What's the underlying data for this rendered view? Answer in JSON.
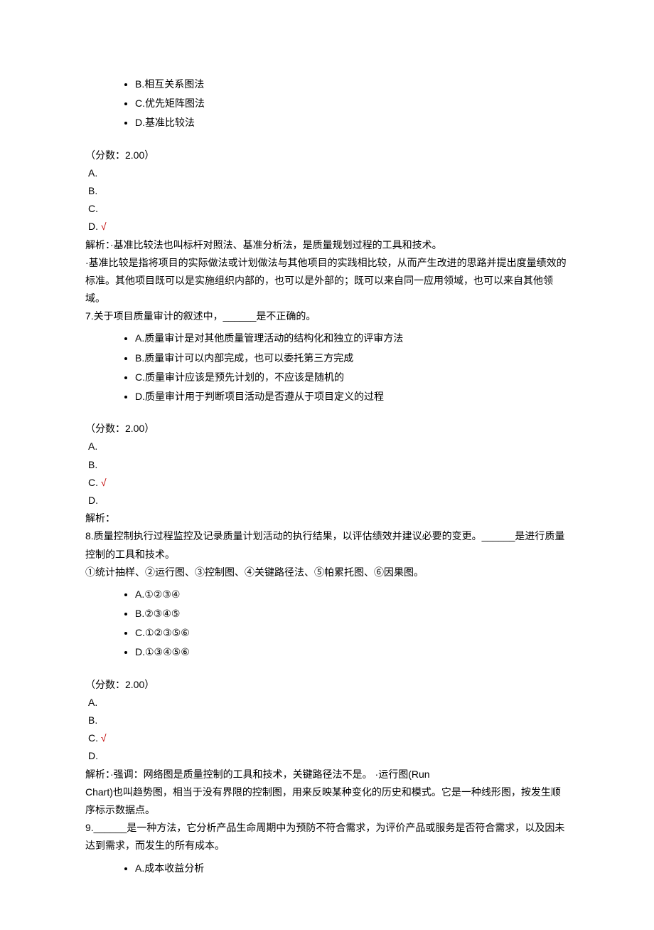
{
  "q6_prev_options": {
    "b": "B.相互关系图法",
    "c": "C.优先矩阵图法",
    "d": "D.基准比较法"
  },
  "q6": {
    "score": "（分数：2.00）",
    "ans_a": " A.",
    "ans_b": " B.",
    "ans_c": " C.",
    "ans_d_prefix": " D. ",
    "ans_d_mark": "√",
    "explain_l1": "解析：·基准比较法也叫标杆对照法、基准分析法，是质量规划过程的工具和技术。",
    "explain_l2": "·基准比较是指将项目的实际做法或计划做法与其他项目的实践相比较，从而产生改进的思路并提出度量绩效的标准。其他项目既可以是实施组织内部的，也可以是外部的；既可以来自同一应用领域，也可以来自其他领域。"
  },
  "q7": {
    "stem": "7.关于项目质量审计的叙述中，______是不正确的。",
    "opt_a": "A.质量审计是对其他质量管理活动的结构化和独立的评审方法",
    "opt_b": "B.质量审计可以内部完成，也可以委托第三方完成",
    "opt_c": "C.质量审计应该是预先计划的，不应该是随机的",
    "opt_d": "D.质量审计用于判断项目活动是否遵从于项目定义的过程",
    "score": "（分数：2.00）",
    "ans_a": " A.",
    "ans_b": " B.",
    "ans_c_prefix": " C. ",
    "ans_c_mark": "√",
    "ans_d": " D.",
    "explain": "解析："
  },
  "q8": {
    "stem_l1": "8.质量控制执行过程监控及记录质量计划活动的执行结果，以评估绩效并建议必要的变更。______是进行质量控制的工具和技术。",
    "stem_l2": "①统计抽样、②运行图、③控制图、④关键路径法、⑤帕累托图、⑥因果图。",
    "opt_a": "A.①②③④",
    "opt_b": "B.②③④⑤",
    "opt_c": "C.①②③⑤⑥",
    "opt_d": "D.①③④⑤⑥",
    "score": "（分数：2.00）",
    "ans_a": " A.",
    "ans_b": " B.",
    "ans_c_prefix": " C. ",
    "ans_c_mark": "√",
    "ans_d": " D.",
    "explain_l1": "解析：·强调：网络图是质量控制的工具和技术，关键路径法不是。 ·运行图(Run",
    "explain_l2": "Chart)也叫趋势图，相当于没有界限的控制图，用来反映某种变化的历史和模式。它是一种线形图，按发生顺序标示数据点。"
  },
  "q9": {
    "stem": "9.______是一种方法，它分析产品生命周期中为预防不符合需求，为评价产品或服务是否符合需求，以及因未达到需求，而发生的所有成本。",
    "opt_a": "A.成本收益分析"
  }
}
